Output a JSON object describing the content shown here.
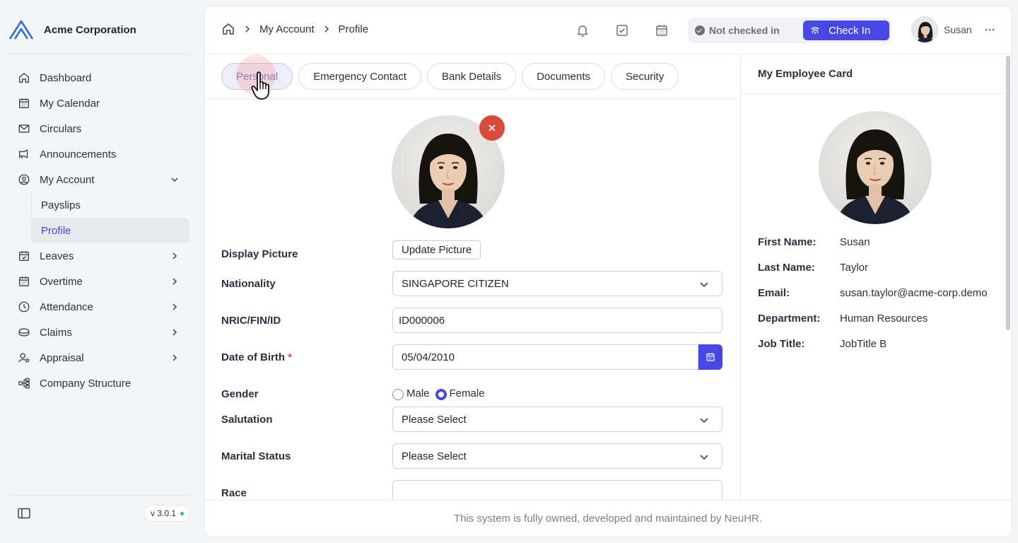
{
  "brand": {
    "name": "Acme Corporation",
    "accent": "#4747e4"
  },
  "sidebar": {
    "items": [
      {
        "label": "Dashboard",
        "icon": "home-icon"
      },
      {
        "label": "My Calendar",
        "icon": "calendar-icon"
      },
      {
        "label": "Circulars",
        "icon": "mail-icon"
      },
      {
        "label": "Announcements",
        "icon": "megaphone-icon"
      },
      {
        "label": "My Account",
        "icon": "user-circle-icon",
        "expanded": true,
        "children": [
          {
            "label": "Payslips"
          },
          {
            "label": "Profile",
            "active": true
          }
        ]
      },
      {
        "label": "Leaves",
        "icon": "calendar-check-icon"
      },
      {
        "label": "Overtime",
        "icon": "calendar-clock-icon"
      },
      {
        "label": "Attendance",
        "icon": "clock-icon"
      },
      {
        "label": "Claims",
        "icon": "coins-icon"
      },
      {
        "label": "Appraisal",
        "icon": "user-star-icon"
      },
      {
        "label": "Company Structure",
        "icon": "org-chart-icon"
      }
    ],
    "version": "v 3.0.1"
  },
  "breadcrumb": {
    "items": [
      "My Account",
      "Profile"
    ]
  },
  "topbar": {
    "status": "Not checked in",
    "check_in_label": "Check In",
    "user_name": "Susan"
  },
  "tabs": [
    {
      "label": "Personal",
      "active": true
    },
    {
      "label": "Emergency Contact"
    },
    {
      "label": "Bank Details"
    },
    {
      "label": "Documents"
    },
    {
      "label": "Security"
    }
  ],
  "form": {
    "display_picture_label": "Display Picture",
    "update_picture_label": "Update Picture",
    "nationality": {
      "label": "Nationality",
      "value": "SINGAPORE CITIZEN"
    },
    "nric": {
      "label": "NRIC/FIN/ID",
      "value": "ID000006"
    },
    "dob": {
      "label": "Date of Birth",
      "required": "*",
      "value": "05/04/2010"
    },
    "gender": {
      "label": "Gender",
      "options": [
        "Male",
        "Female"
      ],
      "selected": "Female"
    },
    "salutation": {
      "label": "Salutation",
      "value": "Please Select"
    },
    "marital": {
      "label": "Marital Status",
      "value": "Please Select"
    },
    "race": {
      "label": "Race",
      "value": ""
    }
  },
  "employee_card": {
    "title": "My Employee Card",
    "fields": [
      {
        "key": "First Name:",
        "value": "Susan"
      },
      {
        "key": "Last Name:",
        "value": "Taylor"
      },
      {
        "key": "Email:",
        "value": "susan.taylor@acme-corp.demo"
      },
      {
        "key": "Department:",
        "value": "Human Resources"
      },
      {
        "key": "Job Title:",
        "value": "JobTitle B"
      }
    ]
  },
  "footer": {
    "text": "This system is fully owned, developed and maintained by NeuHR."
  }
}
